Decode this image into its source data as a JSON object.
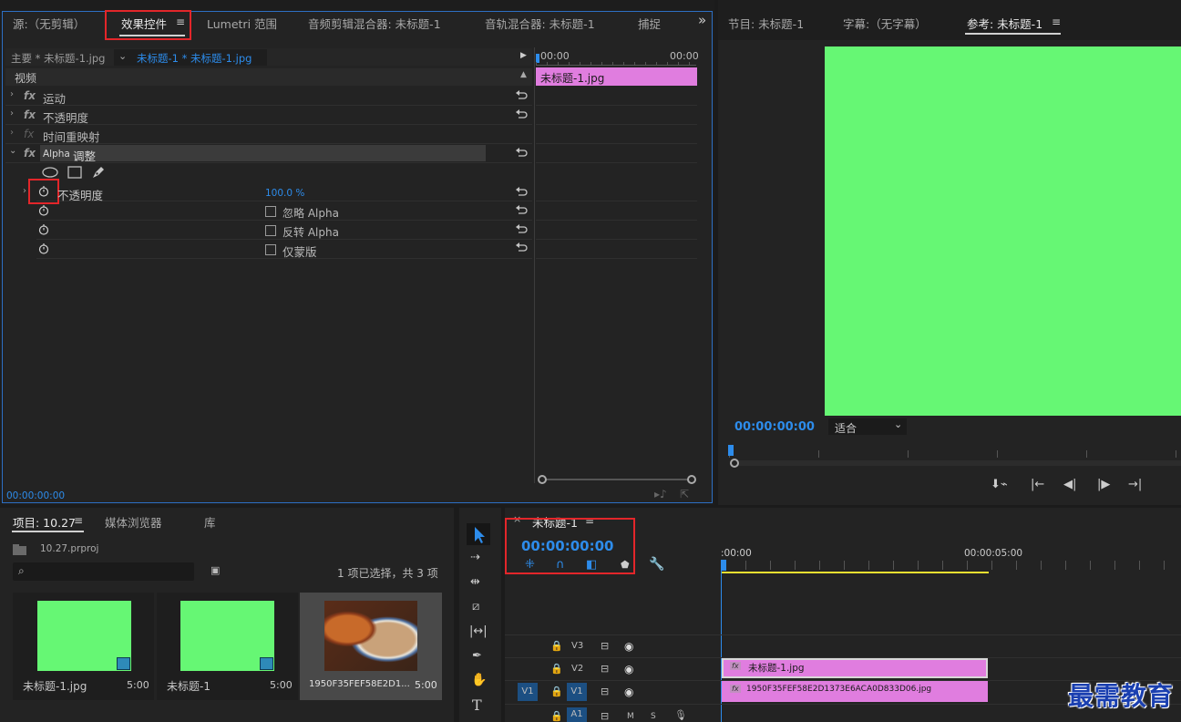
{
  "top_left_panel": {
    "tabs": [
      "源:（无剪辑）",
      "效果控件",
      "Lumetri 范围",
      "音频剪辑混合器: 未标题-1",
      "音轨混合器: 未标题-1",
      "捕捉"
    ],
    "overflow": "»",
    "clip_master": "主要 * 未标题-1.jpg",
    "clip_sequence": "未标题-1 * 未标题-1.jpg",
    "section_video": "视频",
    "effects": {
      "motion": "运动",
      "opacity": "不透明度",
      "time_remap": "时间重映射",
      "alpha_prefix": "Alpha",
      "alpha_suffix": "调整"
    },
    "props": {
      "opacity_label": "不透明度",
      "opacity_value": "100.0 %",
      "ignore_alpha": "忽略 Alpha",
      "invert_alpha": "反转 Alpha",
      "mask_only": "仅蒙版"
    },
    "mini_timeline": {
      "start": "00:00",
      "end": "00:00",
      "clip": "未标题-1.jpg"
    },
    "timecode": "00:00:00:00"
  },
  "program_panel": {
    "tabs": [
      "节目: 未标题-1",
      "字幕:（无字幕）",
      "参考: 未标题-1"
    ],
    "timecode": "00:00:00:00",
    "fit": "适合",
    "preview_color": "#66f774"
  },
  "project_panel": {
    "tabs": [
      "项目: 10.27",
      "媒体浏览器",
      "库"
    ],
    "file": "10.27.prproj",
    "selection_info": "1 项已选择，共 3 项",
    "items": [
      {
        "name": "未标题-1.jpg",
        "duration": "5:00"
      },
      {
        "name": "未标题-1",
        "duration": "5:00"
      },
      {
        "name": "1950F35FEF58E2D1...",
        "duration": "5:00"
      }
    ]
  },
  "timeline_panel": {
    "title": "未标题-1",
    "timecode": "00:00:00:00",
    "ruler_start": ":00:00",
    "ruler_end": "00:00:05:00",
    "tracks": [
      "V3",
      "V2",
      "V1",
      "A1"
    ],
    "source_v1": "V1",
    "source_a1": "A1",
    "m": "M",
    "s": "S",
    "clip_v2": "未标题-1.jpg",
    "clip_v1": "1950F35FEF58E2D1373E6ACA0D833D06.jpg",
    "clip_color": "#e07ddf"
  },
  "watermark": "最需教育"
}
